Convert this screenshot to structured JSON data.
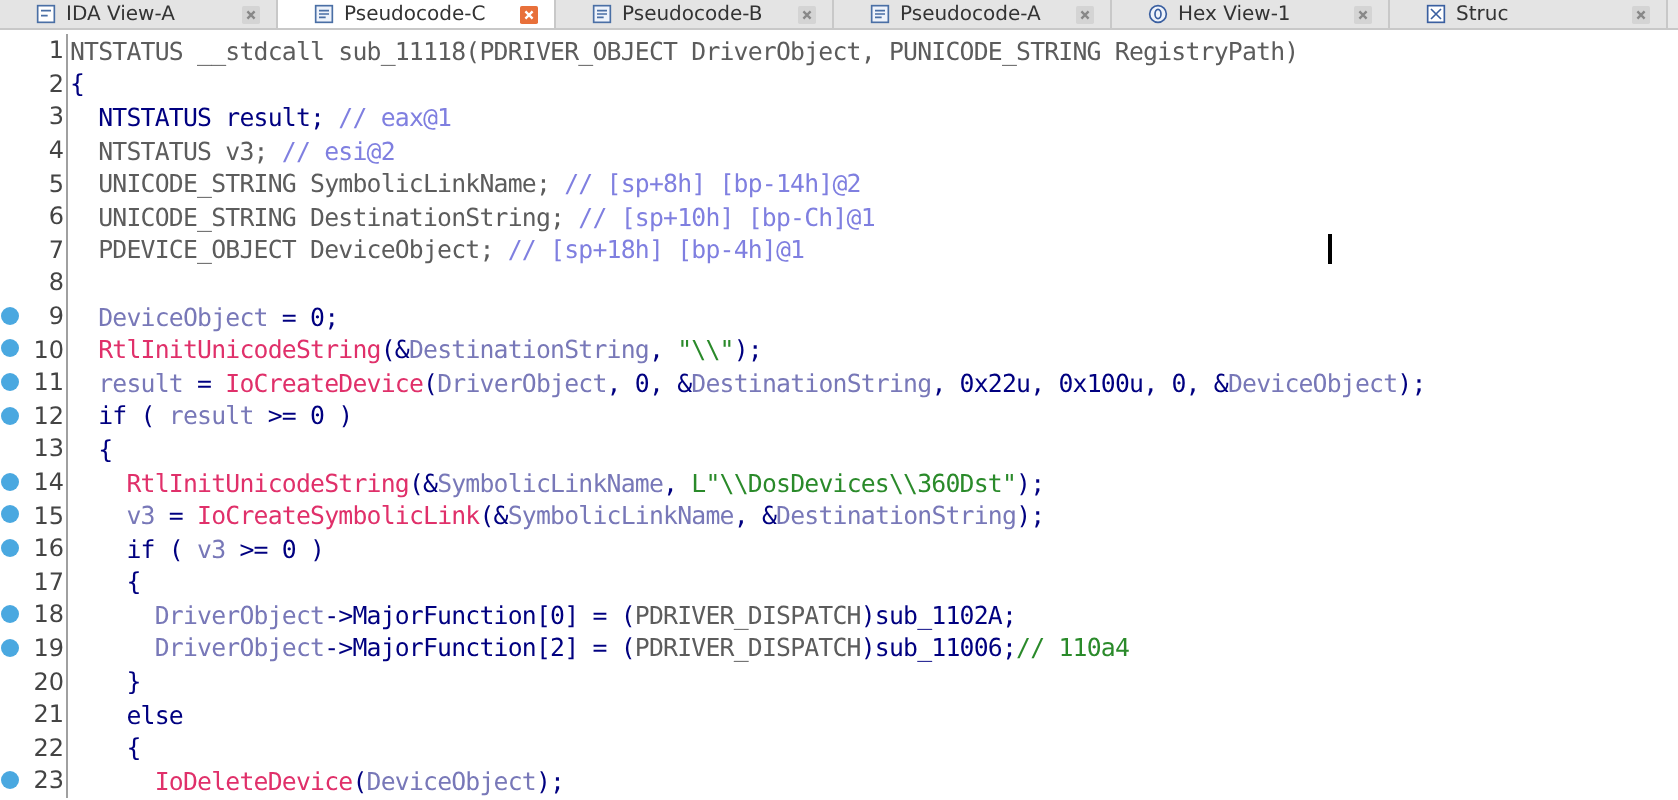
{
  "tabs": [
    {
      "label": "IDA View-A",
      "kind": "graph",
      "selected": false
    },
    {
      "label": "Pseudocode-C",
      "kind": "document",
      "selected": true
    },
    {
      "label": "Pseudocode-B",
      "kind": "document",
      "selected": false
    },
    {
      "label": "Pseudocode-A",
      "kind": "document",
      "selected": false
    },
    {
      "label": "Hex View-1",
      "kind": "hex",
      "selected": false
    },
    {
      "label": "Struc",
      "kind": "struct",
      "selected": false
    }
  ],
  "lines": [
    {
      "number": "1",
      "breakpoint": false,
      "cursor": false,
      "tokens": [
        {
          "text": "NTSTATUS __stdcall sub_11118(PDRIVER_OBJECT DriverObject, PUNICODE_STRING RegistryPath)",
          "kind": "decl"
        }
      ]
    },
    {
      "number": "2",
      "breakpoint": false,
      "cursor": false,
      "tokens": [
        {
          "text": "{",
          "kind": "code"
        }
      ]
    },
    {
      "number": "3",
      "breakpoint": false,
      "cursor": false,
      "tokens": [
        {
          "text": "  NTSTATUS result; ",
          "kind": "code"
        },
        {
          "text": "// eax@1",
          "kind": "comment"
        }
      ]
    },
    {
      "number": "4",
      "breakpoint": false,
      "cursor": false,
      "tokens": [
        {
          "text": "  NTSTATUS v3; ",
          "kind": "decl"
        },
        {
          "text": "// esi@2",
          "kind": "comment"
        }
      ]
    },
    {
      "number": "5",
      "breakpoint": false,
      "cursor": false,
      "tokens": [
        {
          "text": "  UNICODE_STRING SymbolicLinkName; ",
          "kind": "decl"
        },
        {
          "text": "// [sp+8h] [bp-14h]@2",
          "kind": "comment"
        }
      ]
    },
    {
      "number": "6",
      "breakpoint": false,
      "cursor": false,
      "tokens": [
        {
          "text": "  UNICODE_STRING DestinationString; ",
          "kind": "decl"
        },
        {
          "text": "// [sp+10h] [bp-Ch]@1",
          "kind": "comment"
        }
      ]
    },
    {
      "number": "7",
      "breakpoint": false,
      "cursor": true,
      "tokens": [
        {
          "text": "  PDEVICE_OBJECT DeviceObject; ",
          "kind": "decl"
        },
        {
          "text": "// [sp+18h] [bp-4h]@1",
          "kind": "comment"
        }
      ]
    },
    {
      "number": "8",
      "breakpoint": false,
      "cursor": false
    },
    {
      "number": "9",
      "breakpoint": true,
      "cursor": false,
      "tokens": [
        {
          "text": "  DeviceObject",
          "kind": "var"
        },
        {
          "text": " = 0;",
          "kind": "code"
        }
      ]
    },
    {
      "number": "10",
      "breakpoint": true,
      "cursor": false,
      "tokens": [
        {
          "text": "  RtlInitUnicodeString",
          "kind": "func"
        },
        {
          "text": "(&",
          "kind": "code"
        },
        {
          "text": "DestinationString",
          "kind": "var"
        },
        {
          "text": ", ",
          "kind": "code"
        },
        {
          "text": "\"\\\\\"",
          "kind": "string"
        },
        {
          "text": ");",
          "kind": "code"
        }
      ]
    },
    {
      "number": "11",
      "breakpoint": true,
      "cursor": false,
      "tokens": [
        {
          "text": "  result",
          "kind": "var"
        },
        {
          "text": " = ",
          "kind": "code"
        },
        {
          "text": "IoCreateDevice",
          "kind": "func"
        },
        {
          "text": "(",
          "kind": "code"
        },
        {
          "text": "DriverObject",
          "kind": "var"
        },
        {
          "text": ", 0, &",
          "kind": "code"
        },
        {
          "text": "DestinationString",
          "kind": "var"
        },
        {
          "text": ", 0x22u, 0x100u, 0, &",
          "kind": "code"
        },
        {
          "text": "DeviceObject",
          "kind": "var"
        },
        {
          "text": ");",
          "kind": "code"
        }
      ]
    },
    {
      "number": "12",
      "breakpoint": true,
      "cursor": false,
      "tokens": [
        {
          "text": "  if ( ",
          "kind": "code"
        },
        {
          "text": "result",
          "kind": "var"
        },
        {
          "text": " >= 0 )",
          "kind": "code"
        }
      ]
    },
    {
      "number": "13",
      "breakpoint": false,
      "cursor": false,
      "tokens": [
        {
          "text": "  {",
          "kind": "code"
        }
      ]
    },
    {
      "number": "14",
      "breakpoint": true,
      "cursor": false,
      "tokens": [
        {
          "text": "    RtlInitUnicodeString",
          "kind": "func"
        },
        {
          "text": "(&",
          "kind": "code"
        },
        {
          "text": "SymbolicLinkName",
          "kind": "var"
        },
        {
          "text": ", ",
          "kind": "code"
        },
        {
          "text": "L\"\\\\DosDevices\\\\360Dst\"",
          "kind": "string"
        },
        {
          "text": ");",
          "kind": "code"
        }
      ]
    },
    {
      "number": "15",
      "breakpoint": true,
      "cursor": false,
      "tokens": [
        {
          "text": "    v3",
          "kind": "var"
        },
        {
          "text": " = ",
          "kind": "code"
        },
        {
          "text": "IoCreateSymbolicLink",
          "kind": "func"
        },
        {
          "text": "(&",
          "kind": "code"
        },
        {
          "text": "SymbolicLinkName",
          "kind": "var"
        },
        {
          "text": ", &",
          "kind": "code"
        },
        {
          "text": "DestinationString",
          "kind": "var"
        },
        {
          "text": ");",
          "kind": "code"
        }
      ]
    },
    {
      "number": "16",
      "breakpoint": true,
      "cursor": false,
      "tokens": [
        {
          "text": "    if ( ",
          "kind": "code"
        },
        {
          "text": "v3",
          "kind": "var"
        },
        {
          "text": " >= 0 )",
          "kind": "code"
        }
      ]
    },
    {
      "number": "17",
      "breakpoint": false,
      "cursor": false,
      "tokens": [
        {
          "text": "    {",
          "kind": "code"
        }
      ]
    },
    {
      "number": "18",
      "breakpoint": true,
      "cursor": false,
      "tokens": [
        {
          "text": "      DriverObject",
          "kind": "var"
        },
        {
          "text": "->MajorFunction[0] = (",
          "kind": "code"
        },
        {
          "text": "PDRIVER_DISPATCH",
          "kind": "decl"
        },
        {
          "text": ")sub_1102A;",
          "kind": "code"
        }
      ]
    },
    {
      "number": "19",
      "breakpoint": true,
      "cursor": false,
      "tokens": [
        {
          "text": "      DriverObject",
          "kind": "var"
        },
        {
          "text": "->MajorFunction[2] = (",
          "kind": "code"
        },
        {
          "text": "PDRIVER_DISPATCH",
          "kind": "decl"
        },
        {
          "text": ")sub_11006;",
          "kind": "code"
        },
        {
          "text": "// 110a4",
          "kind": "string"
        }
      ]
    },
    {
      "number": "20",
      "breakpoint": false,
      "cursor": false,
      "tokens": [
        {
          "text": "    }",
          "kind": "code"
        }
      ]
    },
    {
      "number": "21",
      "breakpoint": false,
      "cursor": false,
      "tokens": [
        {
          "text": "    else",
          "kind": "code"
        }
      ]
    },
    {
      "number": "22",
      "breakpoint": false,
      "cursor": false,
      "tokens": [
        {
          "text": "    {",
          "kind": "code"
        }
      ]
    },
    {
      "number": "23",
      "breakpoint": true,
      "cursor": false,
      "tokens": [
        {
          "text": "      IoDeleteDevice",
          "kind": "func"
        },
        {
          "text": "(",
          "kind": "code"
        },
        {
          "text": "DeviceObject",
          "kind": "var"
        },
        {
          "text": ");",
          "kind": "code"
        }
      ]
    }
  ]
}
